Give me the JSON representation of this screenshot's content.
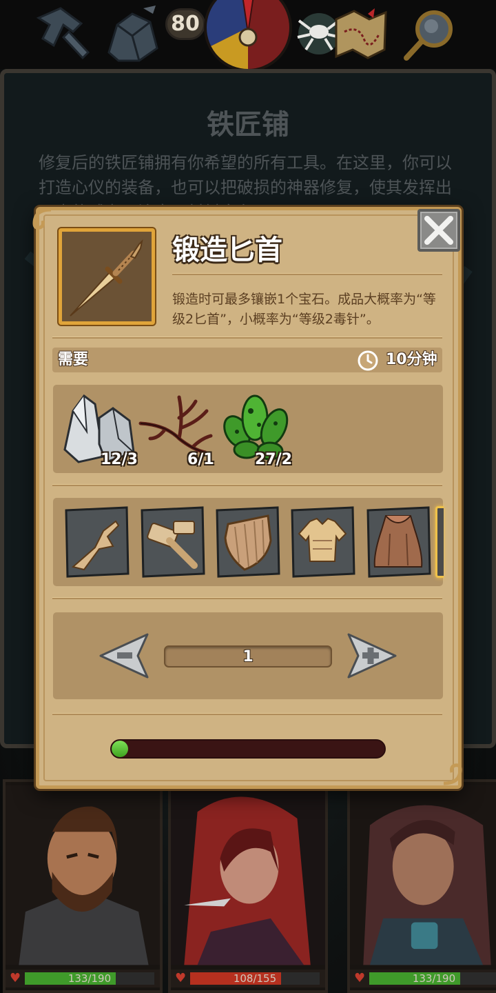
{
  "top_bar": {
    "day_counter": "80",
    "icons": [
      "tools-icon",
      "ore-pile-icon",
      "compass-icon",
      "spider-icon",
      "map-icon",
      "magnifier-icon"
    ]
  },
  "background_panel": {
    "title": "铁匠铺",
    "description": "修复后的铁匠铺拥有你希望的所有工具。在这里，你可以打造心仪的装备，也可以把破损的神器修复，使其发挥出更大的威力。注意，材料自备！"
  },
  "craft_dialog": {
    "item_icon": "dagger-icon",
    "item_name": "锻造匕首",
    "item_description": "锻造时可最多镶嵌1个宝石。成品大概率为“等级2匕首”，小概率为“等级2毒针”。",
    "requirements_label": "需要",
    "duration": "10分钟",
    "materials": [
      {
        "icon": "iron-ore-icon",
        "count": "12/3"
      },
      {
        "icon": "dead-branch-icon",
        "count": "6/1"
      },
      {
        "icon": "green-crystal-icon",
        "count": "27/2"
      }
    ],
    "recipes": [
      {
        "icon": "dagger-blueprint-icon"
      },
      {
        "icon": "hammer-blueprint-icon"
      },
      {
        "icon": "shield-blueprint-icon"
      },
      {
        "icon": "armor-blueprint-icon"
      },
      {
        "icon": "cloak-blueprint-icon"
      }
    ],
    "quantity": "1",
    "progress_fraction": 0.06
  },
  "characters": [
    {
      "name_icon": "bearded-warrior-portrait",
      "hp": "133/190",
      "hp_fraction": 0.7,
      "hp_color": "#3f9a2a"
    },
    {
      "name_icon": "red-hood-rogue-portrait",
      "hp": "108/155",
      "hp_fraction": 0.7,
      "hp_color": "#b5301f"
    },
    {
      "name_icon": "hooded-hunter-portrait",
      "hp": "133/190",
      "hp_fraction": 0.7,
      "hp_color": "#3f9a2a"
    }
  ],
  "colors": {
    "parchment": "#cfb383",
    "frame_gold": "#e0a43a",
    "progress_green": "#5bc236",
    "hp_green": "#3f9a2a",
    "hp_red": "#b5301f"
  }
}
